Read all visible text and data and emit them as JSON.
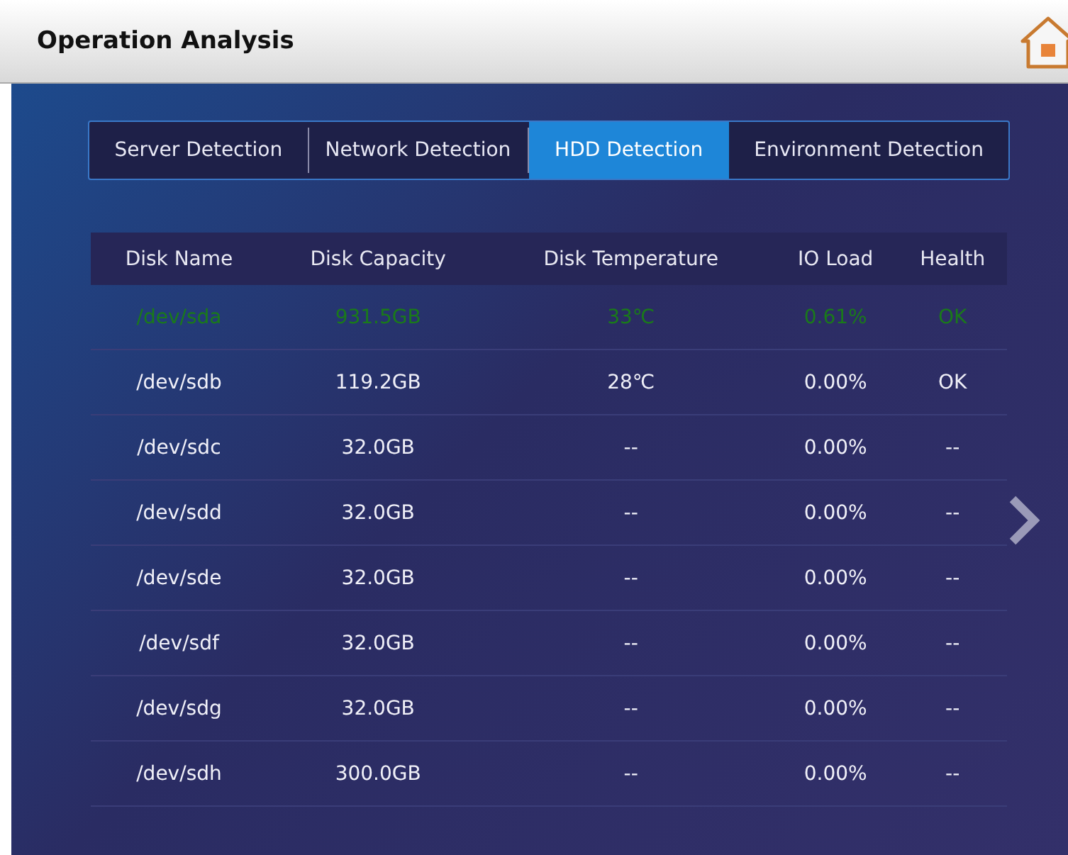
{
  "window": {
    "title": "Operation Analysis"
  },
  "tabs": [
    {
      "label": "Server Detection",
      "selected": false
    },
    {
      "label": "Network Detection",
      "selected": false
    },
    {
      "label": "HDD Detection",
      "selected": true
    },
    {
      "label": "Environment Detection",
      "selected": false
    }
  ],
  "table": {
    "columns": [
      "Disk Name",
      "Disk Capacity",
      "Disk Temperature",
      "IO Load",
      "Health"
    ],
    "rows": [
      {
        "selected": true,
        "cells": [
          "/dev/sda",
          "931.5GB",
          "33℃",
          "0.61%",
          "OK"
        ]
      },
      {
        "selected": false,
        "cells": [
          "/dev/sdb",
          "119.2GB",
          "28℃",
          "0.00%",
          "OK"
        ]
      },
      {
        "selected": false,
        "cells": [
          "/dev/sdc",
          "32.0GB",
          "--",
          "0.00%",
          "--"
        ]
      },
      {
        "selected": false,
        "cells": [
          "/dev/sdd",
          "32.0GB",
          "--",
          "0.00%",
          "--"
        ]
      },
      {
        "selected": false,
        "cells": [
          "/dev/sde",
          "32.0GB",
          "--",
          "0.00%",
          "--"
        ]
      },
      {
        "selected": false,
        "cells": [
          "/dev/sdf",
          "32.0GB",
          "--",
          "0.00%",
          "--"
        ]
      },
      {
        "selected": false,
        "cells": [
          "/dev/sdg",
          "32.0GB",
          "--",
          "0.00%",
          "--"
        ]
      },
      {
        "selected": false,
        "cells": [
          "/dev/sdh",
          "300.0GB",
          "--",
          "0.00%",
          "--"
        ]
      }
    ]
  }
}
